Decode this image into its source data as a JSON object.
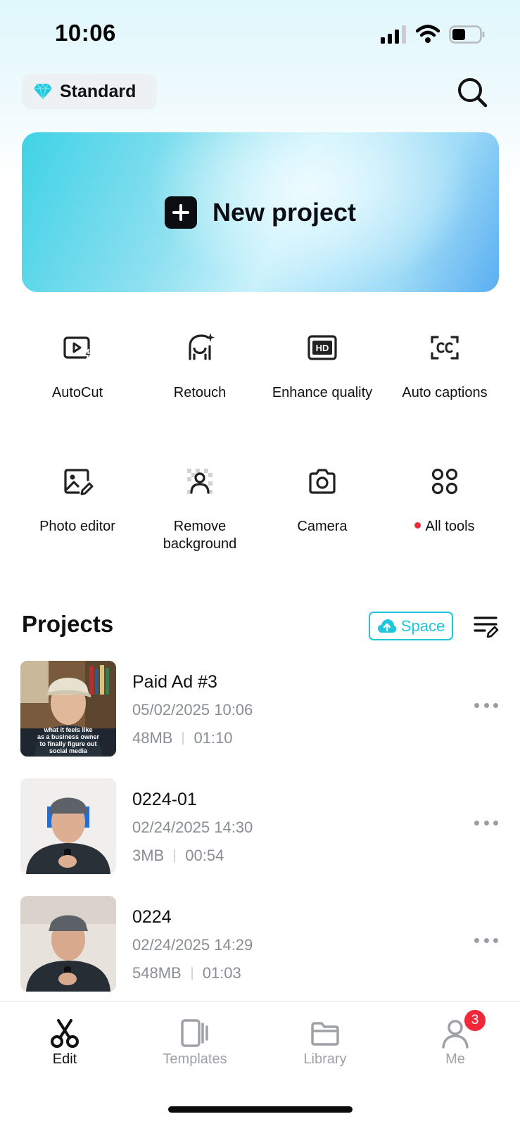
{
  "status_bar": {
    "time": "10:06"
  },
  "header": {
    "plan_label": "Standard"
  },
  "new_project": {
    "label": "New project"
  },
  "tools": [
    {
      "label": "AutoCut",
      "icon": "autocut-icon"
    },
    {
      "label": "Retouch",
      "icon": "retouch-icon"
    },
    {
      "label": "Enhance quality",
      "icon": "hd-icon"
    },
    {
      "label": "Auto captions",
      "icon": "captions-icon"
    },
    {
      "label": "Photo editor",
      "icon": "photo-edit-icon"
    },
    {
      "label": "Remove\nbackground",
      "icon": "remove-bg-icon"
    },
    {
      "label": "Camera",
      "icon": "camera-icon"
    },
    {
      "label": "All tools",
      "icon": "grid-icon"
    }
  ],
  "projects_section": {
    "title": "Projects",
    "space_label": "Space"
  },
  "projects": [
    {
      "name": "Paid Ad #3",
      "date": "05/02/2025 10:06",
      "size": "48MB",
      "duration": "01:10",
      "caption": "what it feels like as a business owner to finally figure out social media"
    },
    {
      "name": "0224-01",
      "date": "02/24/2025 14:30",
      "size": "3MB",
      "duration": "00:54"
    },
    {
      "name": "0224",
      "date": "02/24/2025 14:29",
      "size": "548MB",
      "duration": "01:03"
    }
  ],
  "tabbar": {
    "tabs": [
      {
        "label": "Edit"
      },
      {
        "label": "Templates"
      },
      {
        "label": "Library"
      },
      {
        "label": "Me",
        "badge": "3"
      }
    ]
  },
  "colors": {
    "accent": "#1ec7dc",
    "badge": "#f0283a",
    "text": "#111111",
    "muted": "#8a8d93"
  }
}
